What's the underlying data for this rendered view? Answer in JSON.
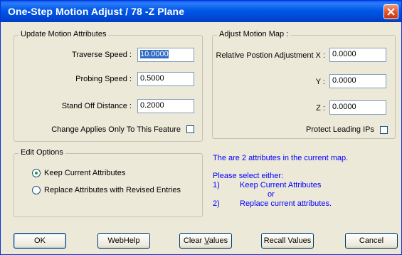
{
  "window": {
    "title": "One-Step Motion Adjust /   78 -Z Plane"
  },
  "update_motion": {
    "group_title": "Update Motion Attributes",
    "traverse_speed": {
      "label": "Traverse Speed :",
      "value": "10.0000"
    },
    "probing_speed": {
      "label": "Probing Speed :",
      "value": "0.5000"
    },
    "stand_off": {
      "label": "Stand Off Distance :",
      "value": "0.2000"
    },
    "change_applies": {
      "label": "Change Applies Only To This Feature",
      "checked": false
    }
  },
  "adjust_map": {
    "group_title": "Adjust Motion Map :",
    "x": {
      "label": "Relative Postion Adjustment X :",
      "value": "0.0000"
    },
    "y": {
      "label": "Y :",
      "value": "0.0000"
    },
    "z": {
      "label": "Z :",
      "value": "0.0000"
    },
    "protect_leading": {
      "label": "Protect Leading IPs",
      "checked": false
    }
  },
  "edit_options": {
    "group_title": "Edit Options",
    "keep": {
      "label": "Keep Current Attributes",
      "selected": true
    },
    "replace": {
      "label": "Replace Attributes with Revised Entries",
      "selected": false
    }
  },
  "info": {
    "line1": "The are 2 attributes in the current map.",
    "line2": "Please select either:",
    "opt1_num": "1)",
    "opt1_text": "Keep Current Attributes",
    "or": "or",
    "opt2_num": "2)",
    "opt2_text": "Replace current attributes."
  },
  "buttons": {
    "ok": "OK",
    "webhelp": "WebHelp",
    "clear_prefix": "Clear ",
    "clear_ul": "V",
    "clear_suffix": "alues",
    "recall": "Recall Values",
    "cancel": "Cancel"
  },
  "colors": {
    "titlebar": "#0058e8",
    "info_text": "#0000ff",
    "dialog_bg": "#ece9d8"
  }
}
